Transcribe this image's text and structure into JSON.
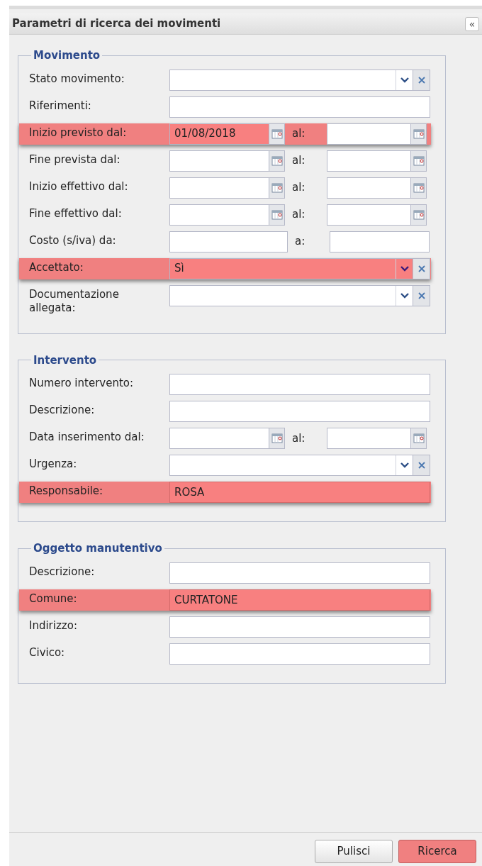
{
  "panel": {
    "title": "Parametri di ricerca dei movimenti",
    "collapse_icon": "«"
  },
  "sections": [
    {
      "legend": "Movimento",
      "rows": [
        {
          "kind": "combo",
          "label": "Stato movimento:",
          "value": "",
          "highlighted": false
        },
        {
          "kind": "text",
          "label": "Riferimenti:",
          "value": "",
          "highlighted": false
        },
        {
          "kind": "daterange",
          "label": "Inizio previsto dal:",
          "value": "01/08/2018",
          "to_label": "al:",
          "to_value": "",
          "highlighted": true
        },
        {
          "kind": "daterange",
          "label": "Fine prevista dal:",
          "value": "",
          "to_label": "al:",
          "to_value": "",
          "highlighted": false
        },
        {
          "kind": "daterange",
          "label": "Inizio effettivo dal:",
          "value": "",
          "to_label": "al:",
          "to_value": "",
          "highlighted": false
        },
        {
          "kind": "daterange",
          "label": "Fine effettivo dal:",
          "value": "",
          "to_label": "al:",
          "to_value": "",
          "highlighted": false
        },
        {
          "kind": "range",
          "label": "Costo (s/iva) da:",
          "value": "",
          "to_label": "a:",
          "to_value": "",
          "highlighted": false
        },
        {
          "kind": "combo",
          "label": "Accettato:",
          "value": "Sì",
          "highlighted": true
        },
        {
          "kind": "combo",
          "label": "Documentazione allegata:",
          "value": "",
          "highlighted": false
        }
      ]
    },
    {
      "legend": "Intervento",
      "rows": [
        {
          "kind": "text",
          "label": "Numero intervento:",
          "value": "",
          "highlighted": false
        },
        {
          "kind": "text",
          "label": "Descrizione:",
          "value": "",
          "highlighted": false
        },
        {
          "kind": "daterange",
          "label": "Data inserimento dal:",
          "value": "",
          "to_label": "al:",
          "to_value": "",
          "highlighted": false
        },
        {
          "kind": "combo",
          "label": "Urgenza:",
          "value": "",
          "highlighted": false
        },
        {
          "kind": "text",
          "label": "Responsabile:",
          "value": "ROSA",
          "highlighted": true
        }
      ]
    },
    {
      "legend": "Oggetto manutentivo",
      "rows": [
        {
          "kind": "text",
          "label": "Descrizione:",
          "value": "",
          "highlighted": false
        },
        {
          "kind": "text",
          "label": "Comune:",
          "value": "CURTATONE",
          "highlighted": true
        },
        {
          "kind": "text",
          "label": "Indirizzo:",
          "value": "",
          "highlighted": false
        },
        {
          "kind": "text",
          "label": "Civico:",
          "value": "",
          "highlighted": false
        }
      ]
    }
  ],
  "buttons": [
    {
      "label": "Pulisci",
      "highlighted": false
    },
    {
      "label": "Ricerca",
      "highlighted": true
    }
  ]
}
